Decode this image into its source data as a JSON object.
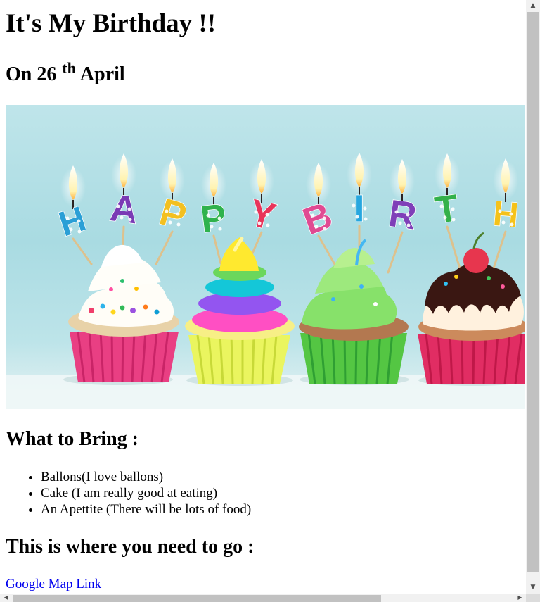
{
  "page": {
    "title": "It's My Birthday !!",
    "date": {
      "prefix": "On 26",
      "suffix": "th",
      "month": "April"
    },
    "hero_image": {
      "alt": "Happy Birthday cupcakes with candles",
      "candle_letters": [
        "H",
        "A",
        "P",
        "P",
        "Y",
        "B",
        "I",
        "R",
        "T",
        "H"
      ],
      "candle_colors": [
        "#2a9fd6",
        "#7a3bb5",
        "#f3c020",
        "#2fb24c",
        "#e8345a",
        "#e04a92",
        "#27a7df",
        "#7f3fb8",
        "#33b14a",
        "#f5c21a"
      ]
    },
    "bring": {
      "heading": "What to Bring :",
      "items": [
        "Ballons(I love ballons)",
        "Cake (I am really good at eating)",
        "An Apettite (There will be lots of food)"
      ]
    },
    "location": {
      "heading": "This is where you need to go :",
      "link_text": "Google Map Link"
    }
  }
}
